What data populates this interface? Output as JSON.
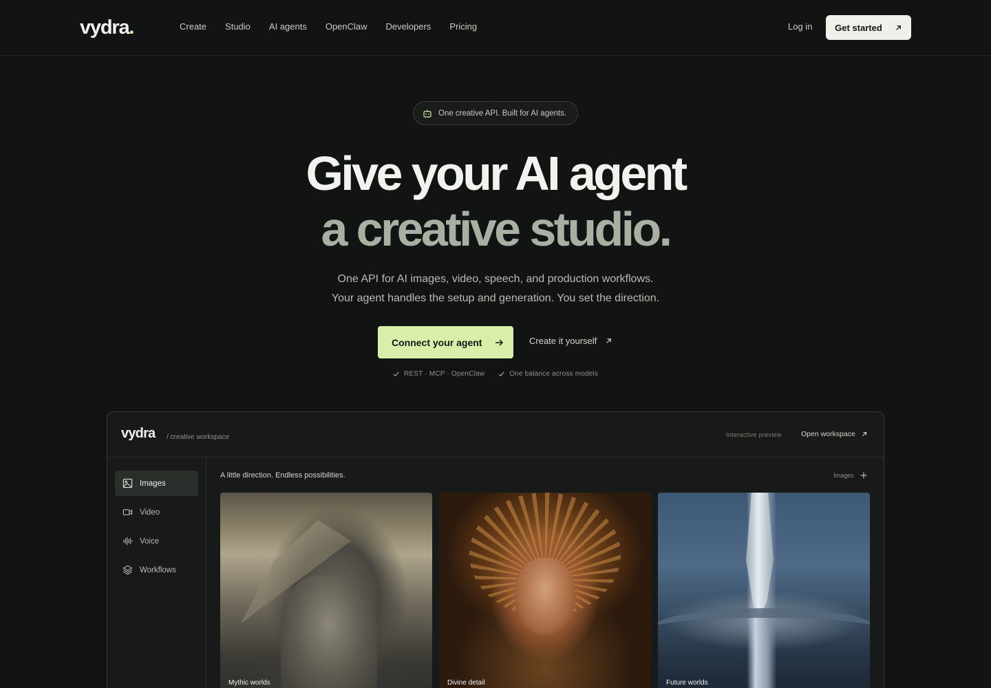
{
  "nav": {
    "logo": "vydra",
    "logo_dot": ".",
    "links": [
      "Create",
      "Studio",
      "AI agents",
      "OpenClaw",
      "Developers",
      "Pricing"
    ],
    "login": "Log in",
    "get_started": "Get started"
  },
  "hero": {
    "pill": "One creative API. Built for AI agents.",
    "headline_1": "Give your AI agent",
    "headline_2": "a creative studio.",
    "sub_1": "One API for AI images, video, speech, and production workflows.",
    "sub_2": "Your agent handles the setup and generation. You set the direction.",
    "connect": "Connect your agent",
    "create_yourself": "Create it yourself",
    "check_1": "REST · MCP · OpenClaw",
    "check_2": "One balance across models"
  },
  "panel": {
    "logo": "vydra",
    "crumb": "/ creative workspace",
    "preview_label": "Interactive preview",
    "open_workspace": "Open workspace",
    "sidebar": [
      "Images",
      "Video",
      "Voice",
      "Workflows"
    ],
    "title": "A little direction. Endless possibilities.",
    "section_label": "Images",
    "cards": [
      "Mythic worlds",
      "Divine detail",
      "Future worlds"
    ]
  },
  "colors": {
    "background": "#121413",
    "accent": "#d7efa8",
    "headline_secondary": "#a7b0a1"
  },
  "icons": [
    "robot-icon",
    "arrow-right-icon",
    "arrow-up-right-icon",
    "check-icon",
    "image-icon",
    "video-icon",
    "waveform-icon",
    "layers-icon",
    "plus-icon"
  ]
}
